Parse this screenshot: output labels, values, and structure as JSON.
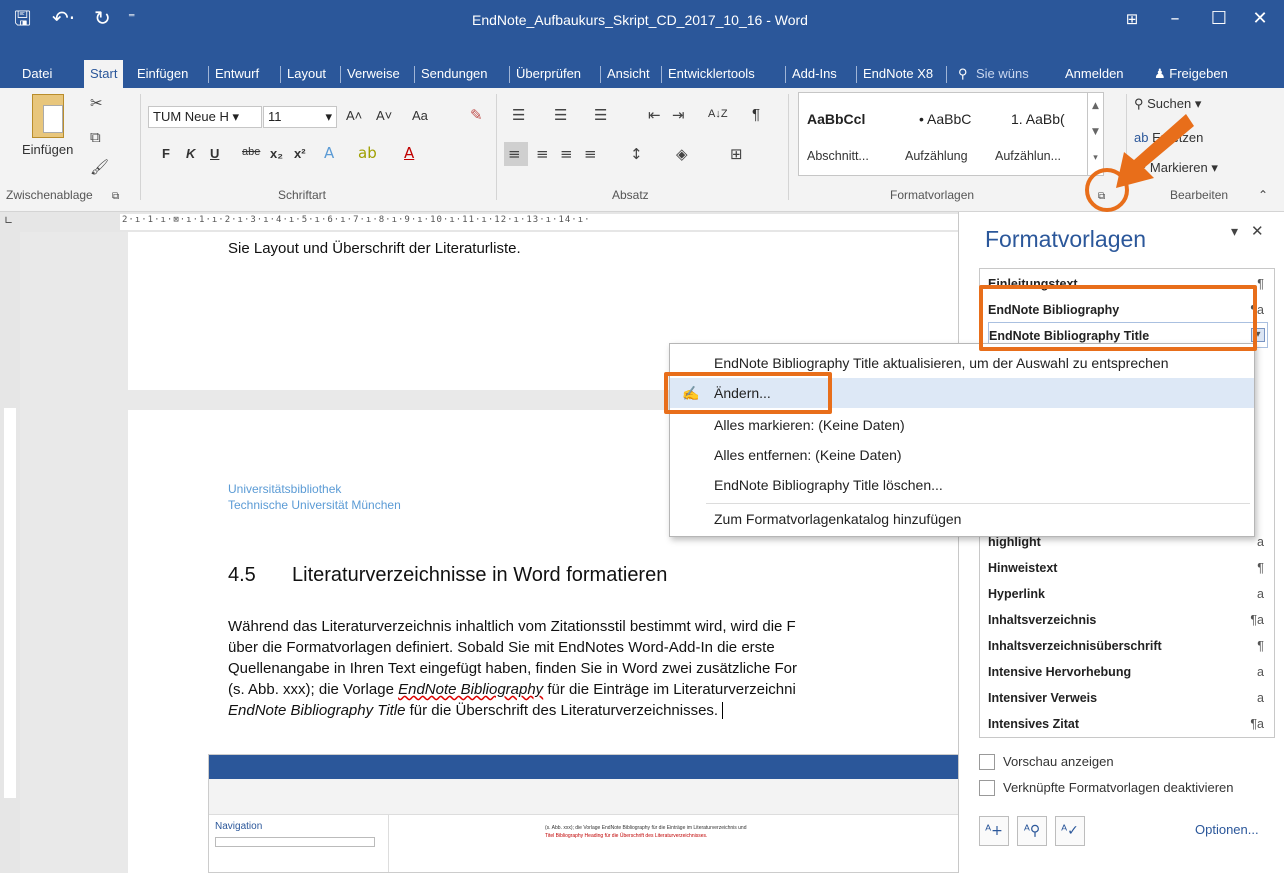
{
  "window": {
    "title": "EndNote_Aufbaukurs_Skript_CD_2017_10_16 - Word",
    "controls": [
      "⊞",
      "–",
      "☐",
      "✕"
    ]
  },
  "quick_access": [
    "🖫",
    "↶·",
    "↻",
    "⁼"
  ],
  "tabs": [
    "Datei",
    "Start",
    "Einfügen",
    "Entwurf",
    "Layout",
    "Verweise",
    "Sendungen",
    "Überprüfen",
    "Ansicht",
    "Entwicklertools",
    "Add-Ins",
    "EndNote X8",
    "Sie wüns",
    "Anmelden",
    "Freigeben"
  ],
  "ribbon": {
    "clipboard": {
      "paste_label": "Einfügen",
      "group": "Zwischenablage"
    },
    "font": {
      "name": "TUM Neue H",
      "size": "11",
      "group": "Schriftart",
      "bold": "F",
      "italic": "K",
      "underline": "U",
      "strike": "abe",
      "sub": "x₂",
      "sup": "x²",
      "grow": "A˄",
      "shrink": "A˅",
      "case": "Aa"
    },
    "paragraph": {
      "group": "Absatz",
      "sort": "A↓Z",
      "pilcrow": "¶"
    },
    "styles": {
      "group": "Formatvorlagen",
      "items": [
        {
          "preview": "AaBbCcl",
          "label": "Abschnitt..."
        },
        {
          "preview": "• AaBbC",
          "label": "Aufzählung"
        },
        {
          "preview": "1. AaBb(",
          "label": "Aufzählun..."
        }
      ]
    },
    "editing": {
      "group": "Bearbeiten",
      "search": "Suchen",
      "replace": "Ersetzen",
      "select": "Markieren"
    }
  },
  "ruler_marks": "2·ı·1·ı·⊠·ı·1·ı·2·ı·3·ı·4·ı·5·ı·6·ı·7·ı·8·ı·9·ı·10·ı·11·ı·12·ı·13·ı·14·ı·",
  "document": {
    "page1_line": "Sie Layout und Überschrift der Literaturliste.",
    "header_line1": "Universitätsbibliothek",
    "header_line2": "Technische Universität München",
    "heading_num": "4.5",
    "heading": "Literaturverzeichnisse in Word formatieren",
    "para": [
      "Während das Literaturverzeichnis inhaltlich vom Zitationsstil bestimmt wird, wird die F",
      "über die Formatvorlagen definiert. Sobald Sie mit EndNotes Word-Add-In die erste",
      "Quellenangabe in Ihren Text eingefügt haben, finden Sie in Word zwei zusätzliche For",
      "(s. Abb. xxx); die Vorlage ",
      "EndNote Bibliography",
      " für die Einträge im Literaturverzeichni",
      "EndNote Bibliography Title",
      " für die Überschrift des Literaturverzeichnisses."
    ]
  },
  "styles_pane": {
    "title": "Formatvorlagen",
    "close": "✕",
    "dropdown": "▾",
    "items": [
      {
        "label": "Einleitungstext",
        "sym": "¶"
      },
      {
        "label": "EndNote Bibliography",
        "sym": "¶a"
      },
      {
        "label": "EndNote Bibliography Title",
        "sym": "▾"
      },
      {
        "label": "highlight",
        "sym": "a"
      },
      {
        "label": "Hinweistext",
        "sym": "¶"
      },
      {
        "label": "Hyperlink",
        "sym": "a"
      },
      {
        "label": "Inhaltsverzeichnis",
        "sym": "¶a"
      },
      {
        "label": "Inhaltsverzeichnisüberschrift",
        "sym": "¶"
      },
      {
        "label": "Intensive Hervorhebung",
        "sym": "a"
      },
      {
        "label": "Intensiver Verweis",
        "sym": "a"
      },
      {
        "label": "Intensives Zitat",
        "sym": "¶a"
      }
    ],
    "preview_label": "Vorschau anzeigen",
    "linked_label": "Verknüpfte Formatvorlagen deaktivieren",
    "options": "Optionen..."
  },
  "context_menu": {
    "items": [
      "EndNote Bibliography Title aktualisieren, um der Auswahl zu entsprechen",
      "Ändern...",
      "Alles markieren: (Keine Daten)",
      "Alles entfernen: (Keine Daten)",
      "EndNote Bibliography Title löschen...",
      "Zum Formatvorlagenkatalog hinzufügen"
    ]
  },
  "thumbnail": {
    "nav_title": "Navigation",
    "caption_line1": "(s. Abb. xxx); die Vorlage EndNote Bibliography für die Einträge im Literaturverzeichnis und",
    "caption_line2": "Titel Bibliography Heading für die Überschrift des Literaturverzeichnisses."
  },
  "colors": {
    "word_blue": "#2b579a",
    "callout": "#e86e1a",
    "link_blue": "#5b9bd5"
  }
}
